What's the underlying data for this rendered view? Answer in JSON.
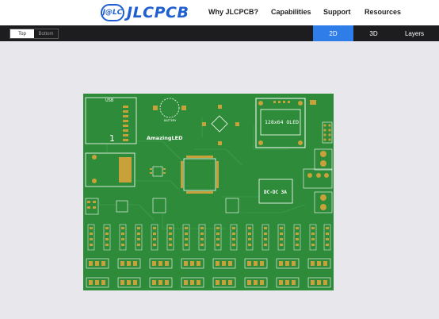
{
  "brand": {
    "badge": "J@LC",
    "name": "JLCPCB",
    "color": "#1f5fd1"
  },
  "nav": {
    "items": [
      {
        "label": "Why JLCPCB?"
      },
      {
        "label": "Capabilities"
      },
      {
        "label": "Support"
      },
      {
        "label": "Resources"
      }
    ]
  },
  "toolbar": {
    "layer_toggle": {
      "top": "Top",
      "bottom": "Bottom",
      "selected": "Top"
    },
    "view_tabs": [
      {
        "label": "2D",
        "active": true
      },
      {
        "label": "3D",
        "active": false
      },
      {
        "label": "Layers",
        "active": false
      }
    ],
    "accent": "#2f7de8"
  },
  "board": {
    "silkscreen": {
      "oled": "128x64 OLED",
      "project": "AmazingLED",
      "dcdc": "DC-DC 3A",
      "battery": "BATTERY",
      "usb": "USB",
      "reset": "RST"
    },
    "colors": {
      "soldermask": "#2e8b3a",
      "copper": "#c9a13a",
      "silk": "#ffffff",
      "trace": "#3aa04a"
    }
  }
}
